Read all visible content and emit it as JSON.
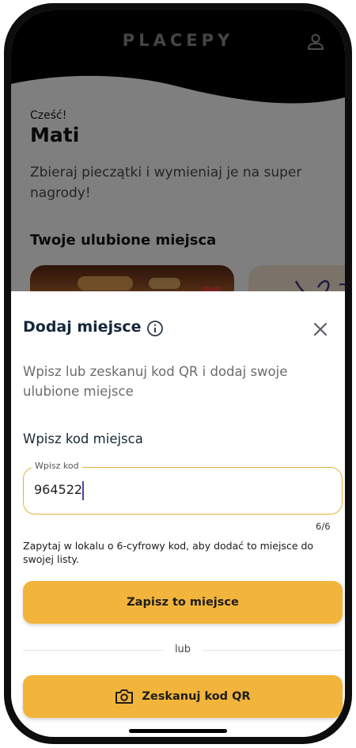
{
  "header": {
    "brand": "PLACEPY",
    "user_icon": "user-icon"
  },
  "home": {
    "greeting": "Cześć!",
    "user_name": "Mati",
    "subtitle": "Zbieraj pieczątki i wymieniaj je na super nagrody!",
    "favorites_title": "Twoje ulubione miejsca"
  },
  "sheet": {
    "title": "Dodaj miejsce",
    "info_icon": "info-icon",
    "close_icon": "close-icon",
    "description": "Wpisz lub zeskanuj kod QR i dodaj swoje ulubione miejsce",
    "code_label": "Wpisz kod miejsca",
    "input_legend": "Wpisz kod",
    "input_value": "964522",
    "counter": "6/6",
    "helper_text": "Zapytaj w lokalu o 6-cyfrowy kod, aby dodać to miejsce do swojej listy.",
    "save_button": "Zapisz to miejsce",
    "or_label": "lub",
    "scan_button": "Zeskanuj kod QR",
    "scan_icon": "camera-icon"
  },
  "colors": {
    "accent": "#f2b43a",
    "input_border": "#e5b23a",
    "title": "#15273a",
    "header_bg": "#000000"
  }
}
